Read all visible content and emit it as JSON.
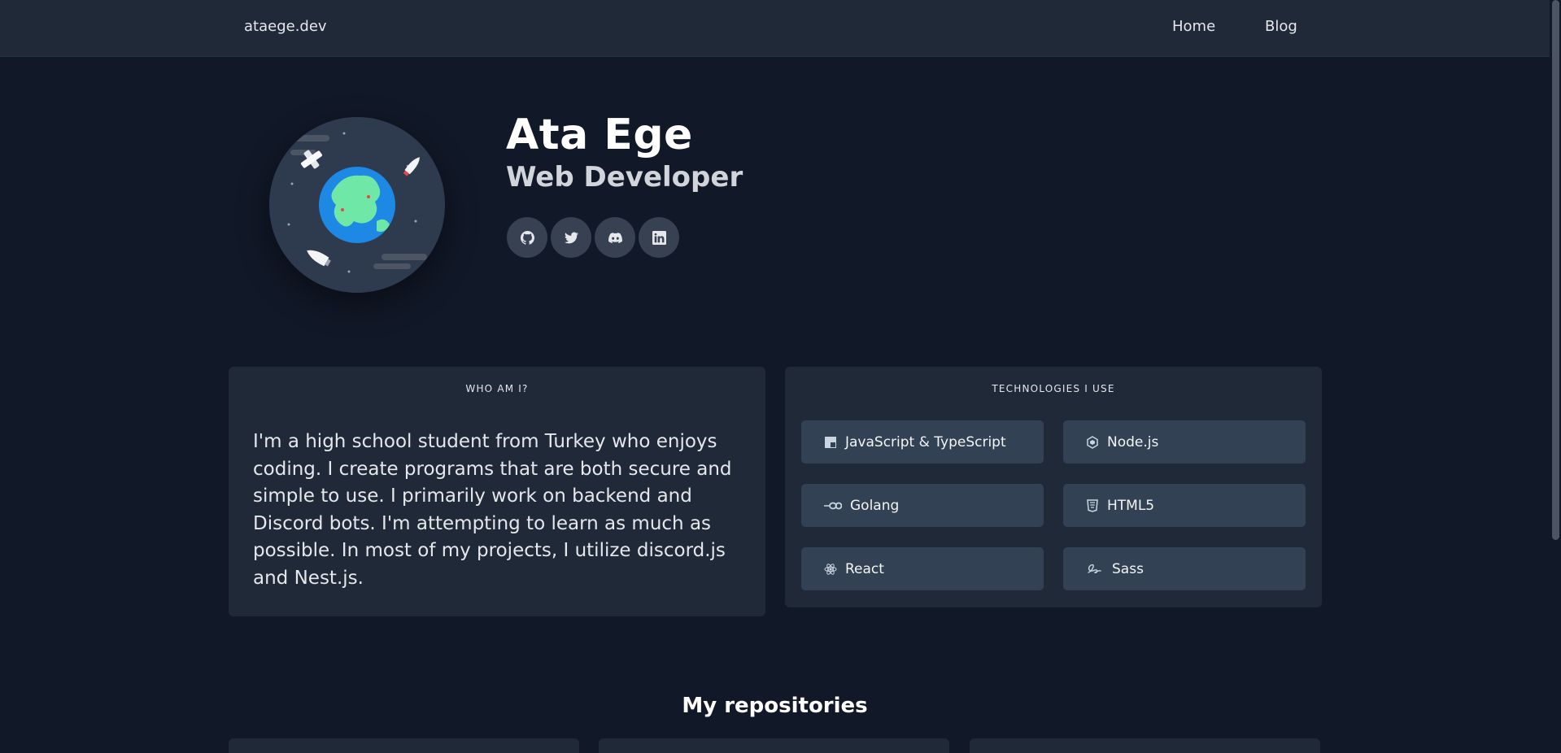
{
  "nav": {
    "brand": "ataege.dev",
    "links": [
      {
        "label": "Home"
      },
      {
        "label": "Blog"
      }
    ]
  },
  "profile": {
    "name": "Ata Ege",
    "role": "Web Developer",
    "socials": [
      {
        "icon": "github-icon"
      },
      {
        "icon": "twitter-icon"
      },
      {
        "icon": "discord-icon"
      },
      {
        "icon": "linkedin-icon"
      }
    ]
  },
  "about": {
    "title": "WHO AM I?",
    "text": "I'm a high school student from Turkey who enjoys coding. I create programs that are both secure and simple to use. I primarily work on backend and Discord bots. I'm attempting to learn as much as possible. In most of my projects, I utilize discord.js and Nest.js."
  },
  "technologies": {
    "title": "TECHNOLOGIES I USE",
    "items": [
      {
        "label": "JavaScript & TypeScript",
        "icon": "javascript-icon"
      },
      {
        "label": "Node.js",
        "icon": "nodejs-icon"
      },
      {
        "label": "Golang",
        "icon": "golang-icon"
      },
      {
        "label": "HTML5",
        "icon": "html5-icon"
      },
      {
        "label": "React",
        "icon": "react-icon"
      },
      {
        "label": "Sass",
        "icon": "sass-icon"
      }
    ]
  },
  "repositories": {
    "title": "My repositories"
  },
  "colors": {
    "background": "#111827",
    "surface": "#1f2937",
    "chip": "#334155",
    "text": "#f3f4f6"
  }
}
